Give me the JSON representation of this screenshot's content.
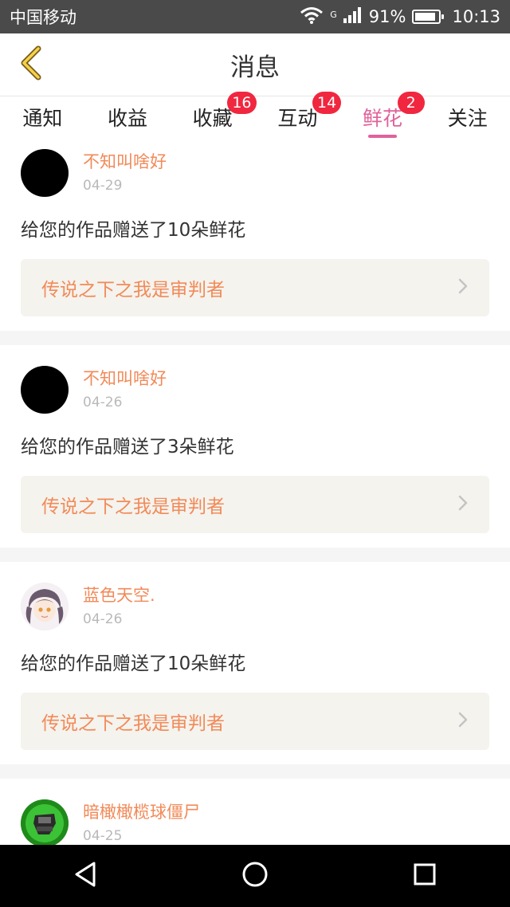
{
  "status_bar": {
    "carrier": "中国移动",
    "network_type": "G",
    "battery": "91%",
    "battery_level": 0.91,
    "time": "10:13"
  },
  "header": {
    "title": "消息",
    "back_icon": "chevron-left-icon"
  },
  "tabs": [
    {
      "label": "通知",
      "badge": ""
    },
    {
      "label": "收益",
      "badge": ""
    },
    {
      "label": "收藏",
      "badge": "16"
    },
    {
      "label": "互动",
      "badge": "14"
    },
    {
      "label": "鲜花",
      "badge": "2",
      "active": true
    },
    {
      "label": "关注",
      "badge": ""
    }
  ],
  "messages": [
    {
      "username": "不知叫啥好",
      "date": "04-29",
      "text": "给您的作品赠送了10朵鲜花",
      "work": "传说之下之我是审判者",
      "avatar": "black-avatar"
    },
    {
      "username": "不知叫啥好",
      "date": "04-26",
      "text": "给您的作品赠送了3朵鲜花",
      "work": "传说之下之我是审判者",
      "avatar": "black-avatar"
    },
    {
      "username": "蓝色天空.",
      "date": "04-26",
      "text": "给您的作品赠送了10朵鲜花",
      "work": "传说之下之我是审判者",
      "avatar": "anime-girl-avatar"
    },
    {
      "username": "暗橄橄榄球僵尸",
      "date": "04-25",
      "text": "",
      "work": "",
      "avatar": "zombie-avatar"
    }
  ],
  "colors": {
    "accent_pink": "#e0629b",
    "username_orange": "#f28a58",
    "badge_red": "#f0273f",
    "status_bar": "#4a4a4a"
  }
}
